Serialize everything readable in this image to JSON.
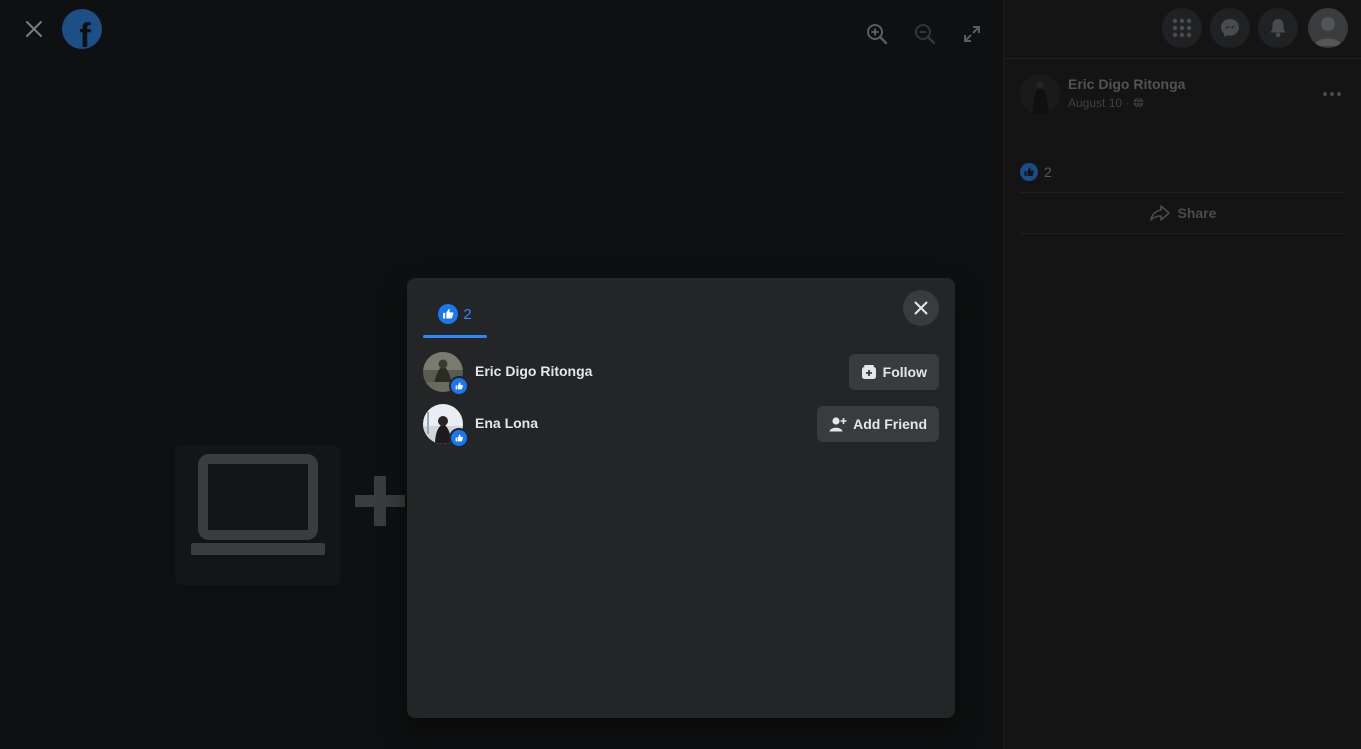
{
  "viewer": {
    "close_icon": "close-icon",
    "logo_icon": "facebook-logo-icon",
    "zoom_in_icon": "zoom-in-icon",
    "zoom_out_icon": "zoom-out-icon",
    "fullscreen_icon": "expand-icon"
  },
  "topbar": {
    "menu_icon": "grid-menu-icon",
    "messenger_icon": "messenger-icon",
    "notifications_icon": "bell-icon",
    "account_icon": "avatar"
  },
  "post": {
    "author": "Eric Digo Ritonga",
    "date": "August 10 ·",
    "privacy_icon": "globe-icon",
    "reaction_count": "2",
    "share_label": "Share"
  },
  "modal": {
    "tab_count": "2",
    "people": [
      {
        "name": "Eric Digo Ritonga",
        "action_label": "Follow",
        "action_icon": "follow-icon"
      },
      {
        "name": "Ena Lona",
        "action_label": "Add Friend",
        "action_icon": "add-friend-icon"
      }
    ]
  },
  "colors": {
    "accent": "#2d88ff",
    "like_blue": "#1877f2",
    "modal_bg": "#242526",
    "button_bg": "#3a3b3c"
  }
}
